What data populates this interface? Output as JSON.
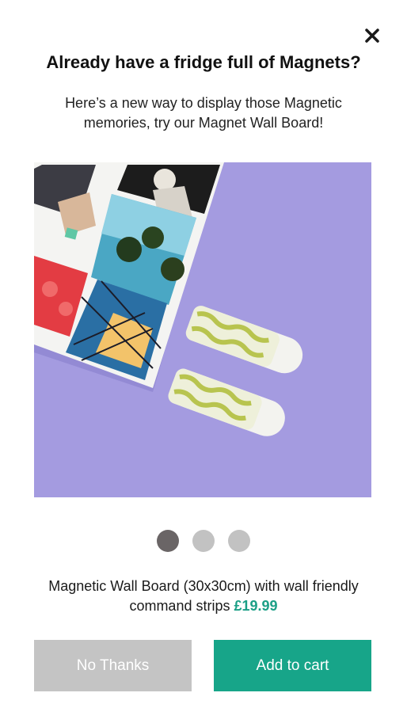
{
  "popup": {
    "title": "Already have a fridge full of Magnets?",
    "subtitle": "Here’s a new way to display those Magnetic memories, try our Magnet Wall Board!",
    "close_icon": "close-icon",
    "image_alt": "Magnet wall board with photo magnets and command strips",
    "carousel": {
      "count": 3,
      "active_index": 0
    },
    "description": "Magnetic Wall Board (30x30cm) with wall friendly command strips",
    "price": "£19.99",
    "buttons": {
      "no_thanks": "No Thanks",
      "add_to_cart": "Add to cart"
    }
  },
  "colors": {
    "accent": "#17a589",
    "price": "#1b9f86",
    "disabled_button": "#c4c4c4",
    "dot_active": "#6a6566",
    "dot_inactive": "#c2c2c2",
    "image_background": "#a49be0"
  }
}
